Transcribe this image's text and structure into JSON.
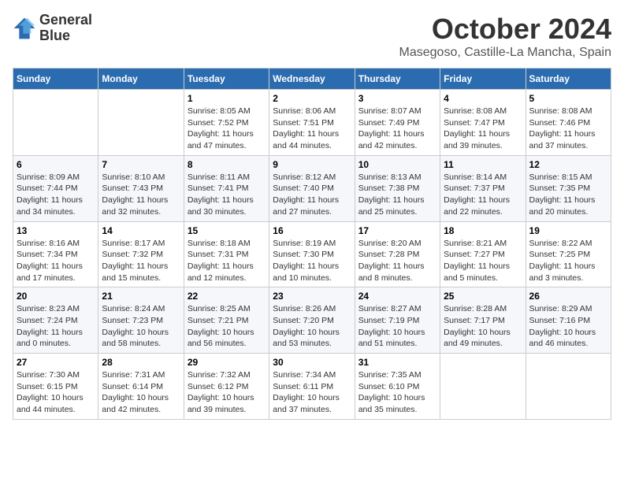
{
  "header": {
    "logo_line1": "General",
    "logo_line2": "Blue",
    "month": "October 2024",
    "location": "Masegoso, Castille-La Mancha, Spain"
  },
  "weekdays": [
    "Sunday",
    "Monday",
    "Tuesday",
    "Wednesday",
    "Thursday",
    "Friday",
    "Saturday"
  ],
  "weeks": [
    [
      {
        "day": "",
        "info": ""
      },
      {
        "day": "",
        "info": ""
      },
      {
        "day": "1",
        "info": "Sunrise: 8:05 AM\nSunset: 7:52 PM\nDaylight: 11 hours and 47 minutes."
      },
      {
        "day": "2",
        "info": "Sunrise: 8:06 AM\nSunset: 7:51 PM\nDaylight: 11 hours and 44 minutes."
      },
      {
        "day": "3",
        "info": "Sunrise: 8:07 AM\nSunset: 7:49 PM\nDaylight: 11 hours and 42 minutes."
      },
      {
        "day": "4",
        "info": "Sunrise: 8:08 AM\nSunset: 7:47 PM\nDaylight: 11 hours and 39 minutes."
      },
      {
        "day": "5",
        "info": "Sunrise: 8:08 AM\nSunset: 7:46 PM\nDaylight: 11 hours and 37 minutes."
      }
    ],
    [
      {
        "day": "6",
        "info": "Sunrise: 8:09 AM\nSunset: 7:44 PM\nDaylight: 11 hours and 34 minutes."
      },
      {
        "day": "7",
        "info": "Sunrise: 8:10 AM\nSunset: 7:43 PM\nDaylight: 11 hours and 32 minutes."
      },
      {
        "day": "8",
        "info": "Sunrise: 8:11 AM\nSunset: 7:41 PM\nDaylight: 11 hours and 30 minutes."
      },
      {
        "day": "9",
        "info": "Sunrise: 8:12 AM\nSunset: 7:40 PM\nDaylight: 11 hours and 27 minutes."
      },
      {
        "day": "10",
        "info": "Sunrise: 8:13 AM\nSunset: 7:38 PM\nDaylight: 11 hours and 25 minutes."
      },
      {
        "day": "11",
        "info": "Sunrise: 8:14 AM\nSunset: 7:37 PM\nDaylight: 11 hours and 22 minutes."
      },
      {
        "day": "12",
        "info": "Sunrise: 8:15 AM\nSunset: 7:35 PM\nDaylight: 11 hours and 20 minutes."
      }
    ],
    [
      {
        "day": "13",
        "info": "Sunrise: 8:16 AM\nSunset: 7:34 PM\nDaylight: 11 hours and 17 minutes."
      },
      {
        "day": "14",
        "info": "Sunrise: 8:17 AM\nSunset: 7:32 PM\nDaylight: 11 hours and 15 minutes."
      },
      {
        "day": "15",
        "info": "Sunrise: 8:18 AM\nSunset: 7:31 PM\nDaylight: 11 hours and 12 minutes."
      },
      {
        "day": "16",
        "info": "Sunrise: 8:19 AM\nSunset: 7:30 PM\nDaylight: 11 hours and 10 minutes."
      },
      {
        "day": "17",
        "info": "Sunrise: 8:20 AM\nSunset: 7:28 PM\nDaylight: 11 hours and 8 minutes."
      },
      {
        "day": "18",
        "info": "Sunrise: 8:21 AM\nSunset: 7:27 PM\nDaylight: 11 hours and 5 minutes."
      },
      {
        "day": "19",
        "info": "Sunrise: 8:22 AM\nSunset: 7:25 PM\nDaylight: 11 hours and 3 minutes."
      }
    ],
    [
      {
        "day": "20",
        "info": "Sunrise: 8:23 AM\nSunset: 7:24 PM\nDaylight: 11 hours and 0 minutes."
      },
      {
        "day": "21",
        "info": "Sunrise: 8:24 AM\nSunset: 7:23 PM\nDaylight: 10 hours and 58 minutes."
      },
      {
        "day": "22",
        "info": "Sunrise: 8:25 AM\nSunset: 7:21 PM\nDaylight: 10 hours and 56 minutes."
      },
      {
        "day": "23",
        "info": "Sunrise: 8:26 AM\nSunset: 7:20 PM\nDaylight: 10 hours and 53 minutes."
      },
      {
        "day": "24",
        "info": "Sunrise: 8:27 AM\nSunset: 7:19 PM\nDaylight: 10 hours and 51 minutes."
      },
      {
        "day": "25",
        "info": "Sunrise: 8:28 AM\nSunset: 7:17 PM\nDaylight: 10 hours and 49 minutes."
      },
      {
        "day": "26",
        "info": "Sunrise: 8:29 AM\nSunset: 7:16 PM\nDaylight: 10 hours and 46 minutes."
      }
    ],
    [
      {
        "day": "27",
        "info": "Sunrise: 7:30 AM\nSunset: 6:15 PM\nDaylight: 10 hours and 44 minutes."
      },
      {
        "day": "28",
        "info": "Sunrise: 7:31 AM\nSunset: 6:14 PM\nDaylight: 10 hours and 42 minutes."
      },
      {
        "day": "29",
        "info": "Sunrise: 7:32 AM\nSunset: 6:12 PM\nDaylight: 10 hours and 39 minutes."
      },
      {
        "day": "30",
        "info": "Sunrise: 7:34 AM\nSunset: 6:11 PM\nDaylight: 10 hours and 37 minutes."
      },
      {
        "day": "31",
        "info": "Sunrise: 7:35 AM\nSunset: 6:10 PM\nDaylight: 10 hours and 35 minutes."
      },
      {
        "day": "",
        "info": ""
      },
      {
        "day": "",
        "info": ""
      }
    ]
  ]
}
